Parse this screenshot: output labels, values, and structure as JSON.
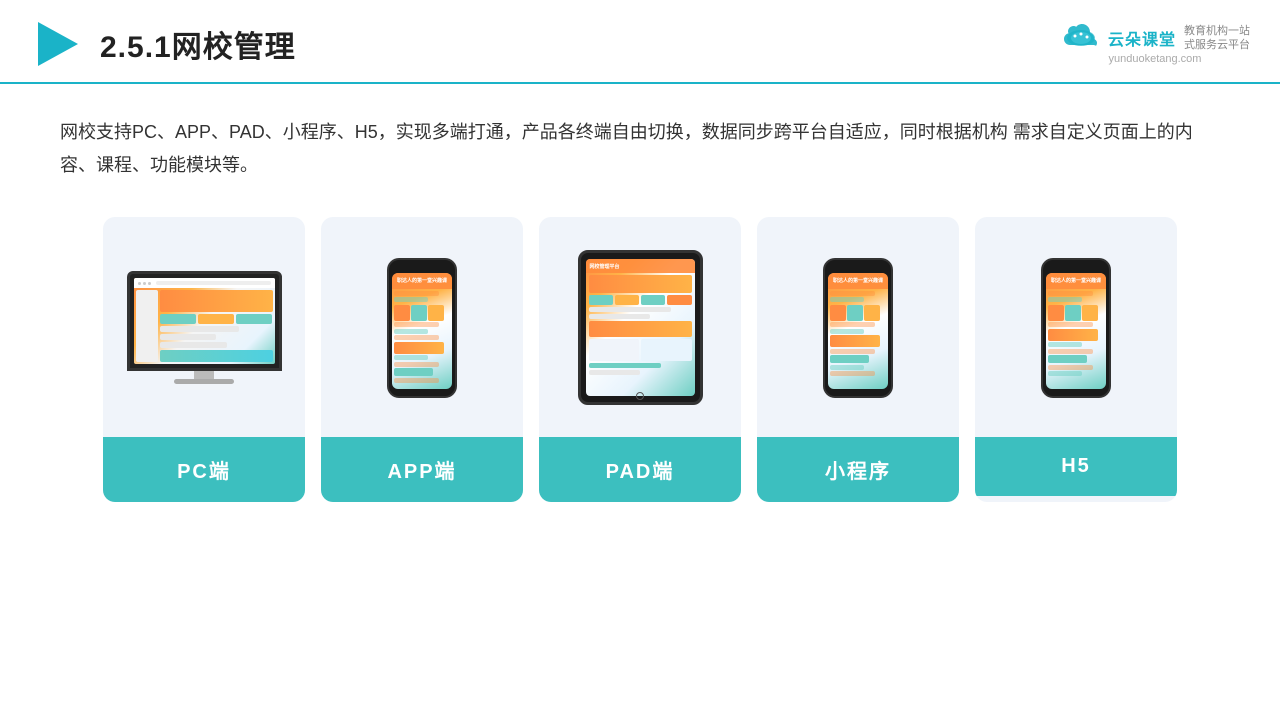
{
  "header": {
    "title": "2.5.1网校管理",
    "brand": {
      "name": "云朵课堂",
      "url": "yunduoketang.com",
      "sub": "教育机构一站\n式服务云平台"
    }
  },
  "description": "网校支持PC、APP、PAD、小程序、H5，实现多端打通，产品各终端自由切换，数据同步跨平台自适应，同时根据机构\n需求自定义页面上的内容、课程、功能模块等。",
  "cards": [
    {
      "id": "pc",
      "label": "PC端",
      "type": "pc"
    },
    {
      "id": "app",
      "label": "APP端",
      "type": "phone"
    },
    {
      "id": "pad",
      "label": "PAD端",
      "type": "tablet"
    },
    {
      "id": "miniprogram",
      "label": "小程序",
      "type": "phone"
    },
    {
      "id": "h5",
      "label": "H5",
      "type": "phone"
    }
  ],
  "accent_color": "#3cbfbf"
}
